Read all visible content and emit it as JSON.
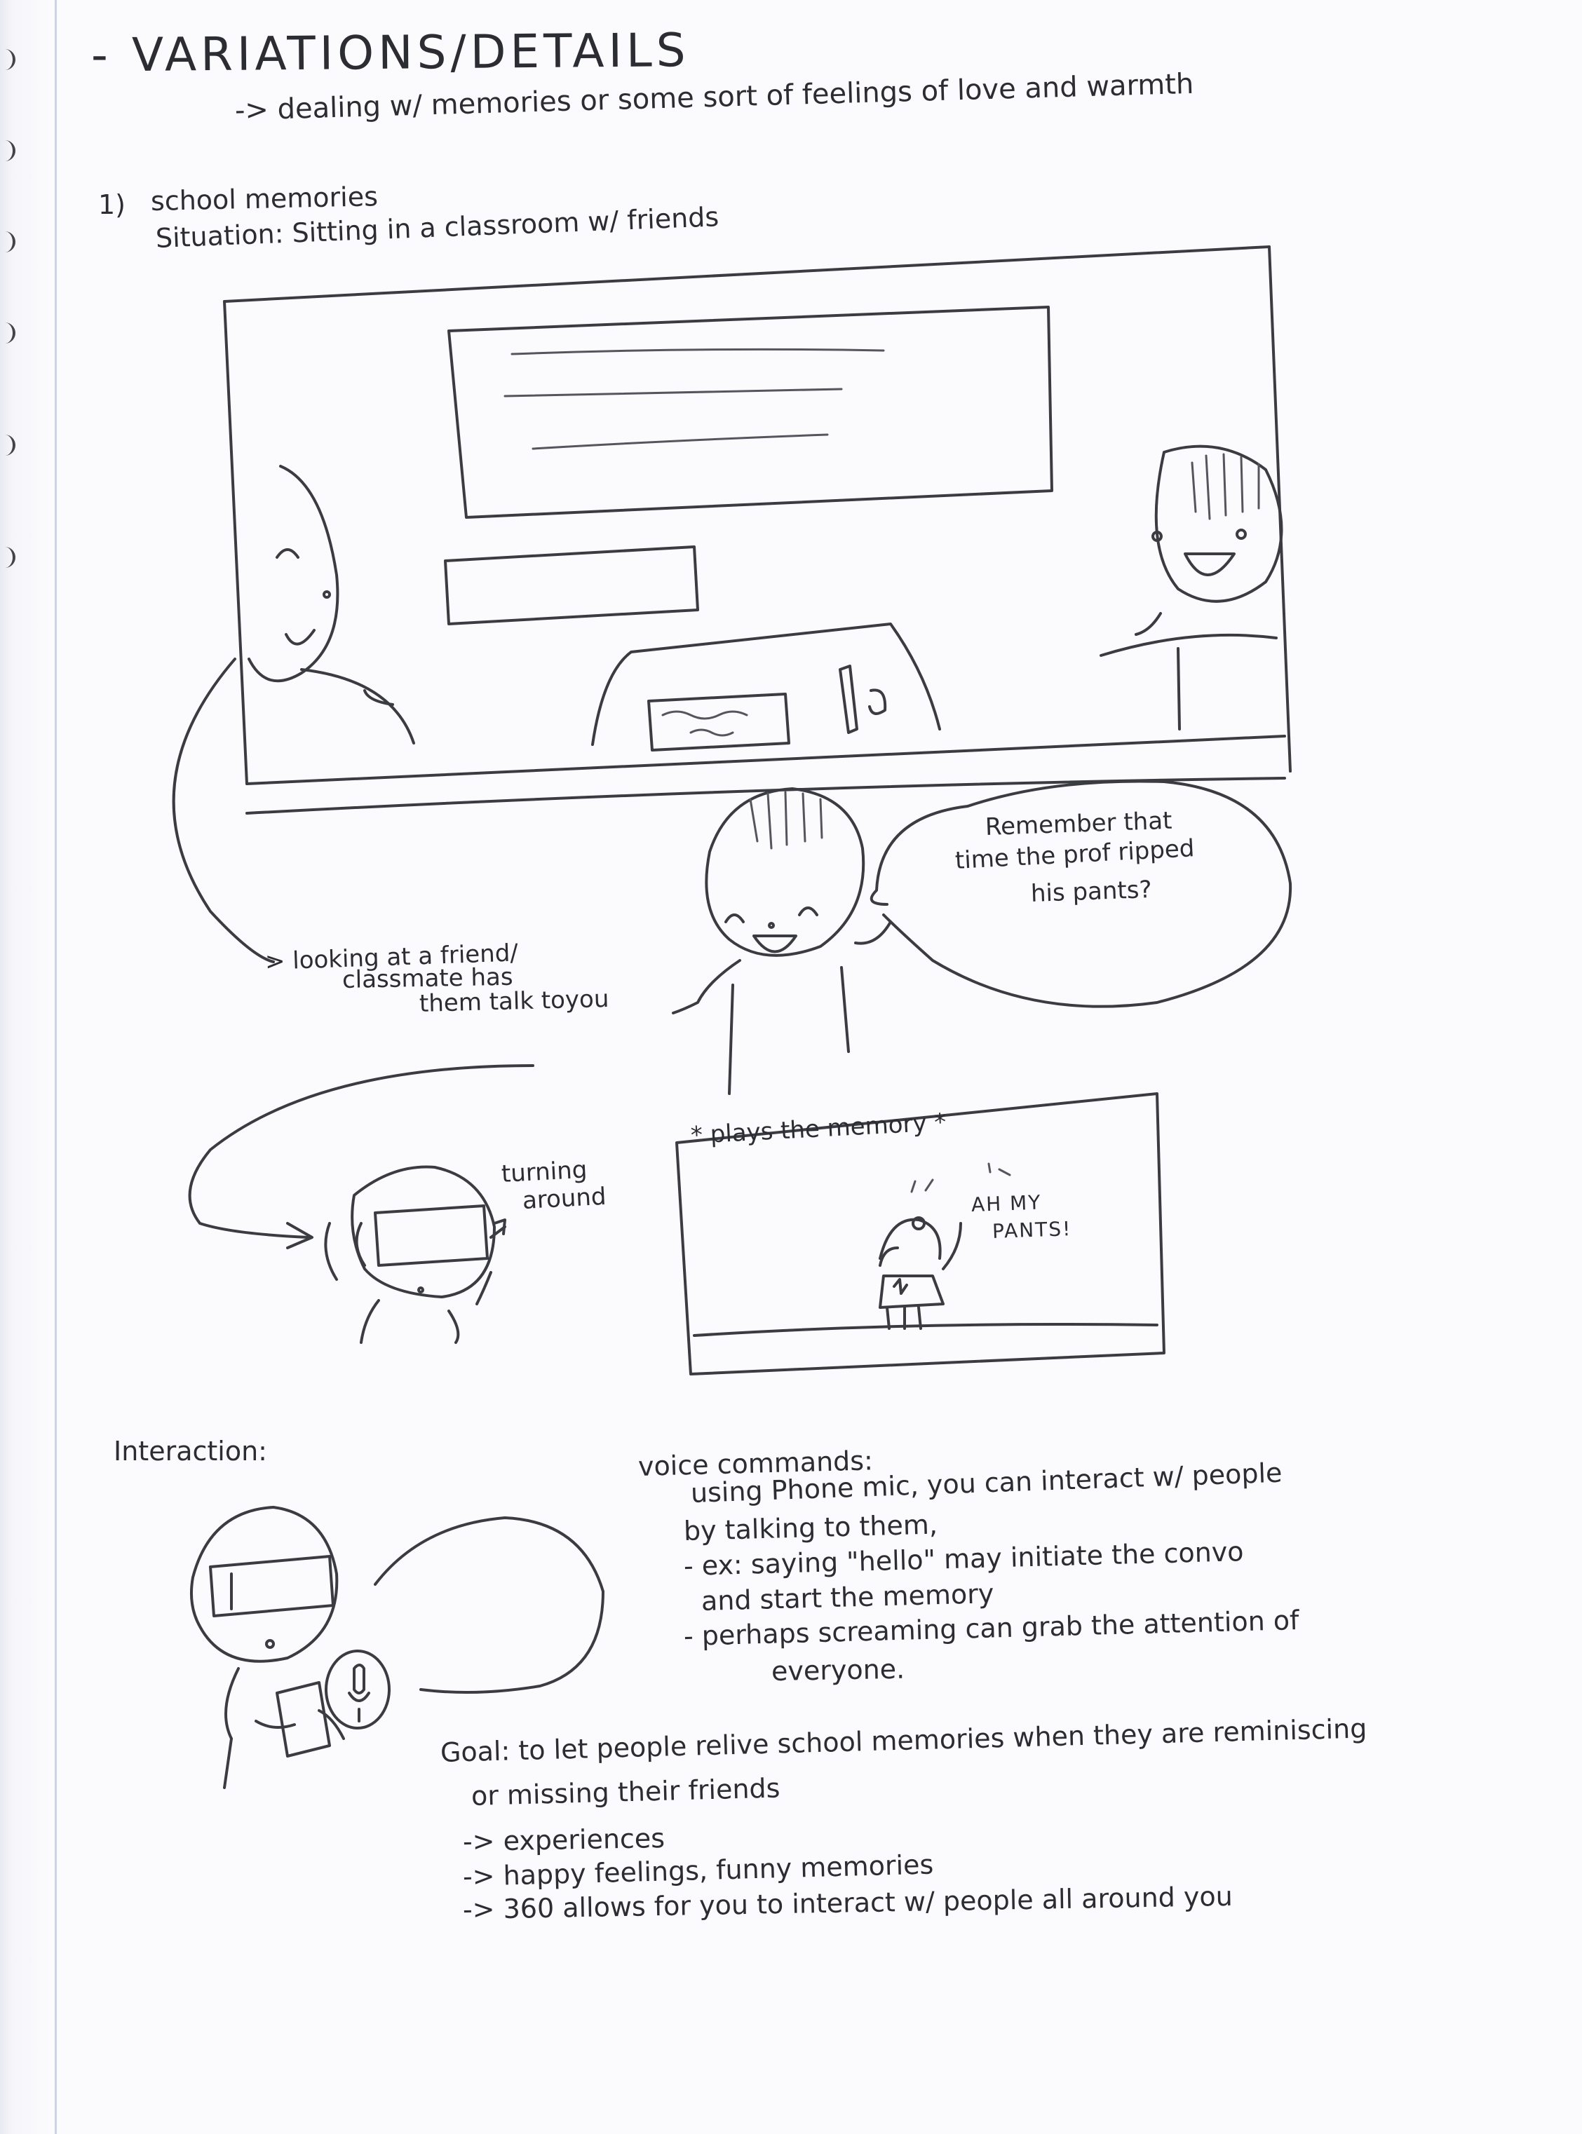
{
  "heading": {
    "dash": "-",
    "title": "VARIATIONS/DETAILS",
    "subtitle": "-> dealing w/ memories or some sort of feelings of love and warmth"
  },
  "section1": {
    "number": "1)",
    "title": "school memories",
    "situation": "Situation: Sitting in a classroom w/ friends"
  },
  "annotations": {
    "looking_line1": "> looking at a friend/",
    "looking_line2": "classmate has",
    "looking_line3": "them talk toyou",
    "turning_line1": "turning",
    "turning_line2": "around",
    "speech_line1": "Remember that",
    "speech_line2": "time the prof ripped",
    "speech_line3": "his pants?",
    "memory_caption": "* plays the memory *",
    "memory_shout_line1": "AH MY",
    "memory_shout_line2": "PANTS!"
  },
  "interaction": {
    "label": "Interaction:",
    "voice_heading": "voice commands:",
    "lines": [
      "using Phone mic, you can interact w/ people",
      "by talking to them,",
      "- ex: saying \"hello\" may initiate the convo",
      "and start the memory",
      "- perhaps screaming can grab the attention of",
      "everyone."
    ]
  },
  "goal": {
    "lines": [
      "Goal: to let people relive school memories when they are reminiscing",
      "or missing their friends",
      "-> experiences",
      "-> happy feelings, funny memories",
      "-> 360 allows for you to interact w/ people all around you"
    ]
  }
}
